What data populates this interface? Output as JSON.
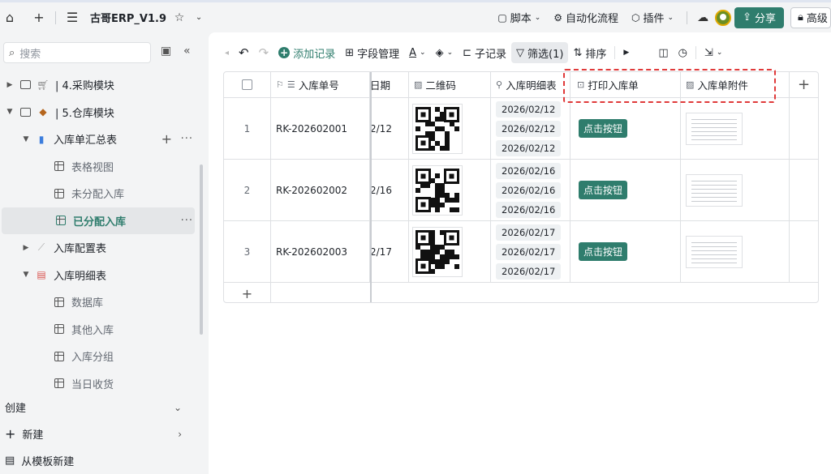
{
  "topbar": {
    "title": "古哥ERP_V1.9",
    "buttons": [
      "脚本",
      "自动化流程",
      "插件"
    ],
    "share": "分享",
    "advanced": "高级"
  },
  "sidebar": {
    "search_placeholder": "搜索",
    "tree": [
      {
        "label": "| 4.采购模块"
      },
      {
        "label": "| 5.仓库模块"
      },
      {
        "label": "入库单汇总表"
      },
      {
        "label": "表格视图"
      },
      {
        "label": "未分配入库"
      },
      {
        "label": "已分配入库"
      },
      {
        "label": "入库配置表"
      },
      {
        "label": "入库明细表"
      },
      {
        "label": "数据库"
      },
      {
        "label": "其他入库"
      },
      {
        "label": "入库分组"
      },
      {
        "label": "当日收货"
      }
    ],
    "footer": {
      "create": "创建",
      "new": "新建",
      "from_template": "从模板新建"
    }
  },
  "toolbar": {
    "add_record": "添加记录",
    "field_manage": "字段管理",
    "sub_record": "子记录",
    "filter": "筛选(1)",
    "sort": "排序"
  },
  "table": {
    "headers": {
      "order_no": "入库单号",
      "date": "日期",
      "qr": "二维码",
      "detail": "入库明细表",
      "print": "打印入库单",
      "attachment": "入库单附件"
    },
    "rows": [
      {
        "index": "1",
        "order_no": "RK-202602001",
        "date": "2/12",
        "dates": [
          "2026/02/12",
          "2026/02/12",
          "2026/02/12"
        ],
        "button": "点击按钮"
      },
      {
        "index": "2",
        "order_no": "RK-202602002",
        "date": "2/16",
        "dates": [
          "2026/02/16",
          "2026/02/16",
          "2026/02/16"
        ],
        "button": "点击按钮"
      },
      {
        "index": "3",
        "order_no": "RK-202602003",
        "date": "2/17",
        "dates": [
          "2026/02/17",
          "2026/02/17",
          "2026/02/17"
        ],
        "button": "点击按钮"
      }
    ]
  },
  "colors": {
    "accent": "#2f7d6d",
    "highlight_border": "#e03a3a"
  }
}
